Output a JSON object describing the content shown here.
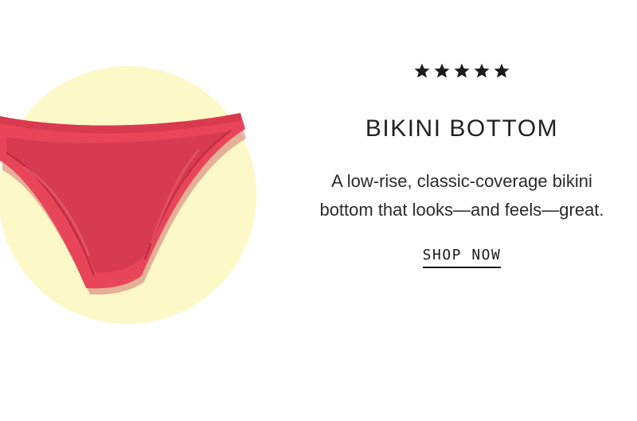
{
  "promo": {
    "rating": {
      "stars": 5,
      "icon": "star-icon",
      "color": "#1a1a1a"
    },
    "title": "BIKINI BOTTOM",
    "description": "A low-rise, classic-coverage bikini bottom that looks—and feels—great.",
    "cta_label": "SHOP NOW"
  },
  "product_image": {
    "icon": "bikini-bottom-image",
    "garment_color": "#e8455a",
    "backdrop_color": "#fdf8c8"
  }
}
